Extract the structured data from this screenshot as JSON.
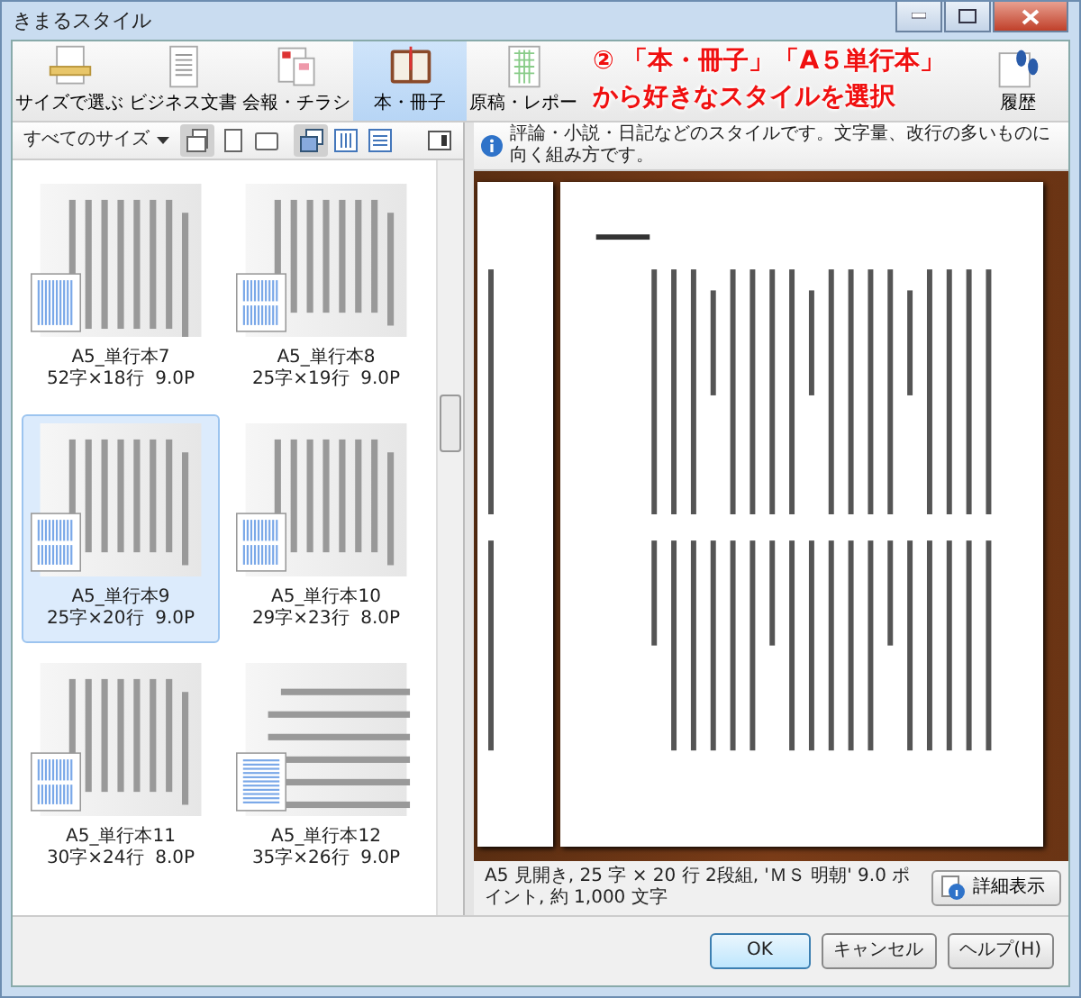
{
  "window": {
    "title": "きまるスタイル"
  },
  "categories": [
    {
      "label": "サイズで選ぶ",
      "selected": false
    },
    {
      "label": "ビジネス文書",
      "selected": false
    },
    {
      "label": "会報・チラシ",
      "selected": false
    },
    {
      "label": "本・冊子",
      "selected": true
    },
    {
      "label": "原稿・レポー",
      "selected": false
    }
  ],
  "history": {
    "label": "履歴"
  },
  "annotation": {
    "lines": [
      "② 「本・冊子」「A５単行本」",
      "から好きなスタイルを選択"
    ]
  },
  "size_filter": {
    "value": "すべてのサイズ"
  },
  "size_toggles": [
    {
      "kind": "both",
      "selected": true
    },
    {
      "kind": "portrait",
      "selected": false
    },
    {
      "kind": "landscape",
      "selected": false
    }
  ],
  "view_toggles": [
    {
      "kind": "tiles",
      "selected": true
    },
    {
      "kind": "columns",
      "selected": false
    },
    {
      "kind": "rows",
      "selected": false
    }
  ],
  "info": {
    "text": "評論・小説・日記などのスタイルです。文字量、改行の多いものに向く組み方です。"
  },
  "styles": [
    {
      "name": "A5_単行本7",
      "spec": "52字×18行  9.0P",
      "kind": "single",
      "selected": false
    },
    {
      "name": "A5_単行本8",
      "spec": "25字×19行  9.0P",
      "kind": "double",
      "selected": false
    },
    {
      "name": "A5_単行本9",
      "spec": "25字×20行  9.0P",
      "kind": "double",
      "selected": true
    },
    {
      "name": "A5_単行本10",
      "spec": "29字×23行  8.0P",
      "kind": "double",
      "selected": false
    },
    {
      "name": "A5_単行本11",
      "spec": "30字×24行  8.0P",
      "kind": "double",
      "selected": false
    },
    {
      "name": "A5_単行本12",
      "spec": "35字×26行  9.0P",
      "kind": "horizontal",
      "selected": false
    }
  ],
  "status": {
    "text": "A5 見開き,  25 字 × 20 行 2段組,  'ＭＳ 明朝' 9.0 ポイント,  約 1,000 文字"
  },
  "detail_button": {
    "label": "詳細表示"
  },
  "buttons": [
    {
      "label": "OK",
      "kind": "default"
    },
    {
      "label": "キャンセル",
      "kind": "normal"
    },
    {
      "label": "ヘルプ(H)",
      "kind": "normal"
    }
  ]
}
